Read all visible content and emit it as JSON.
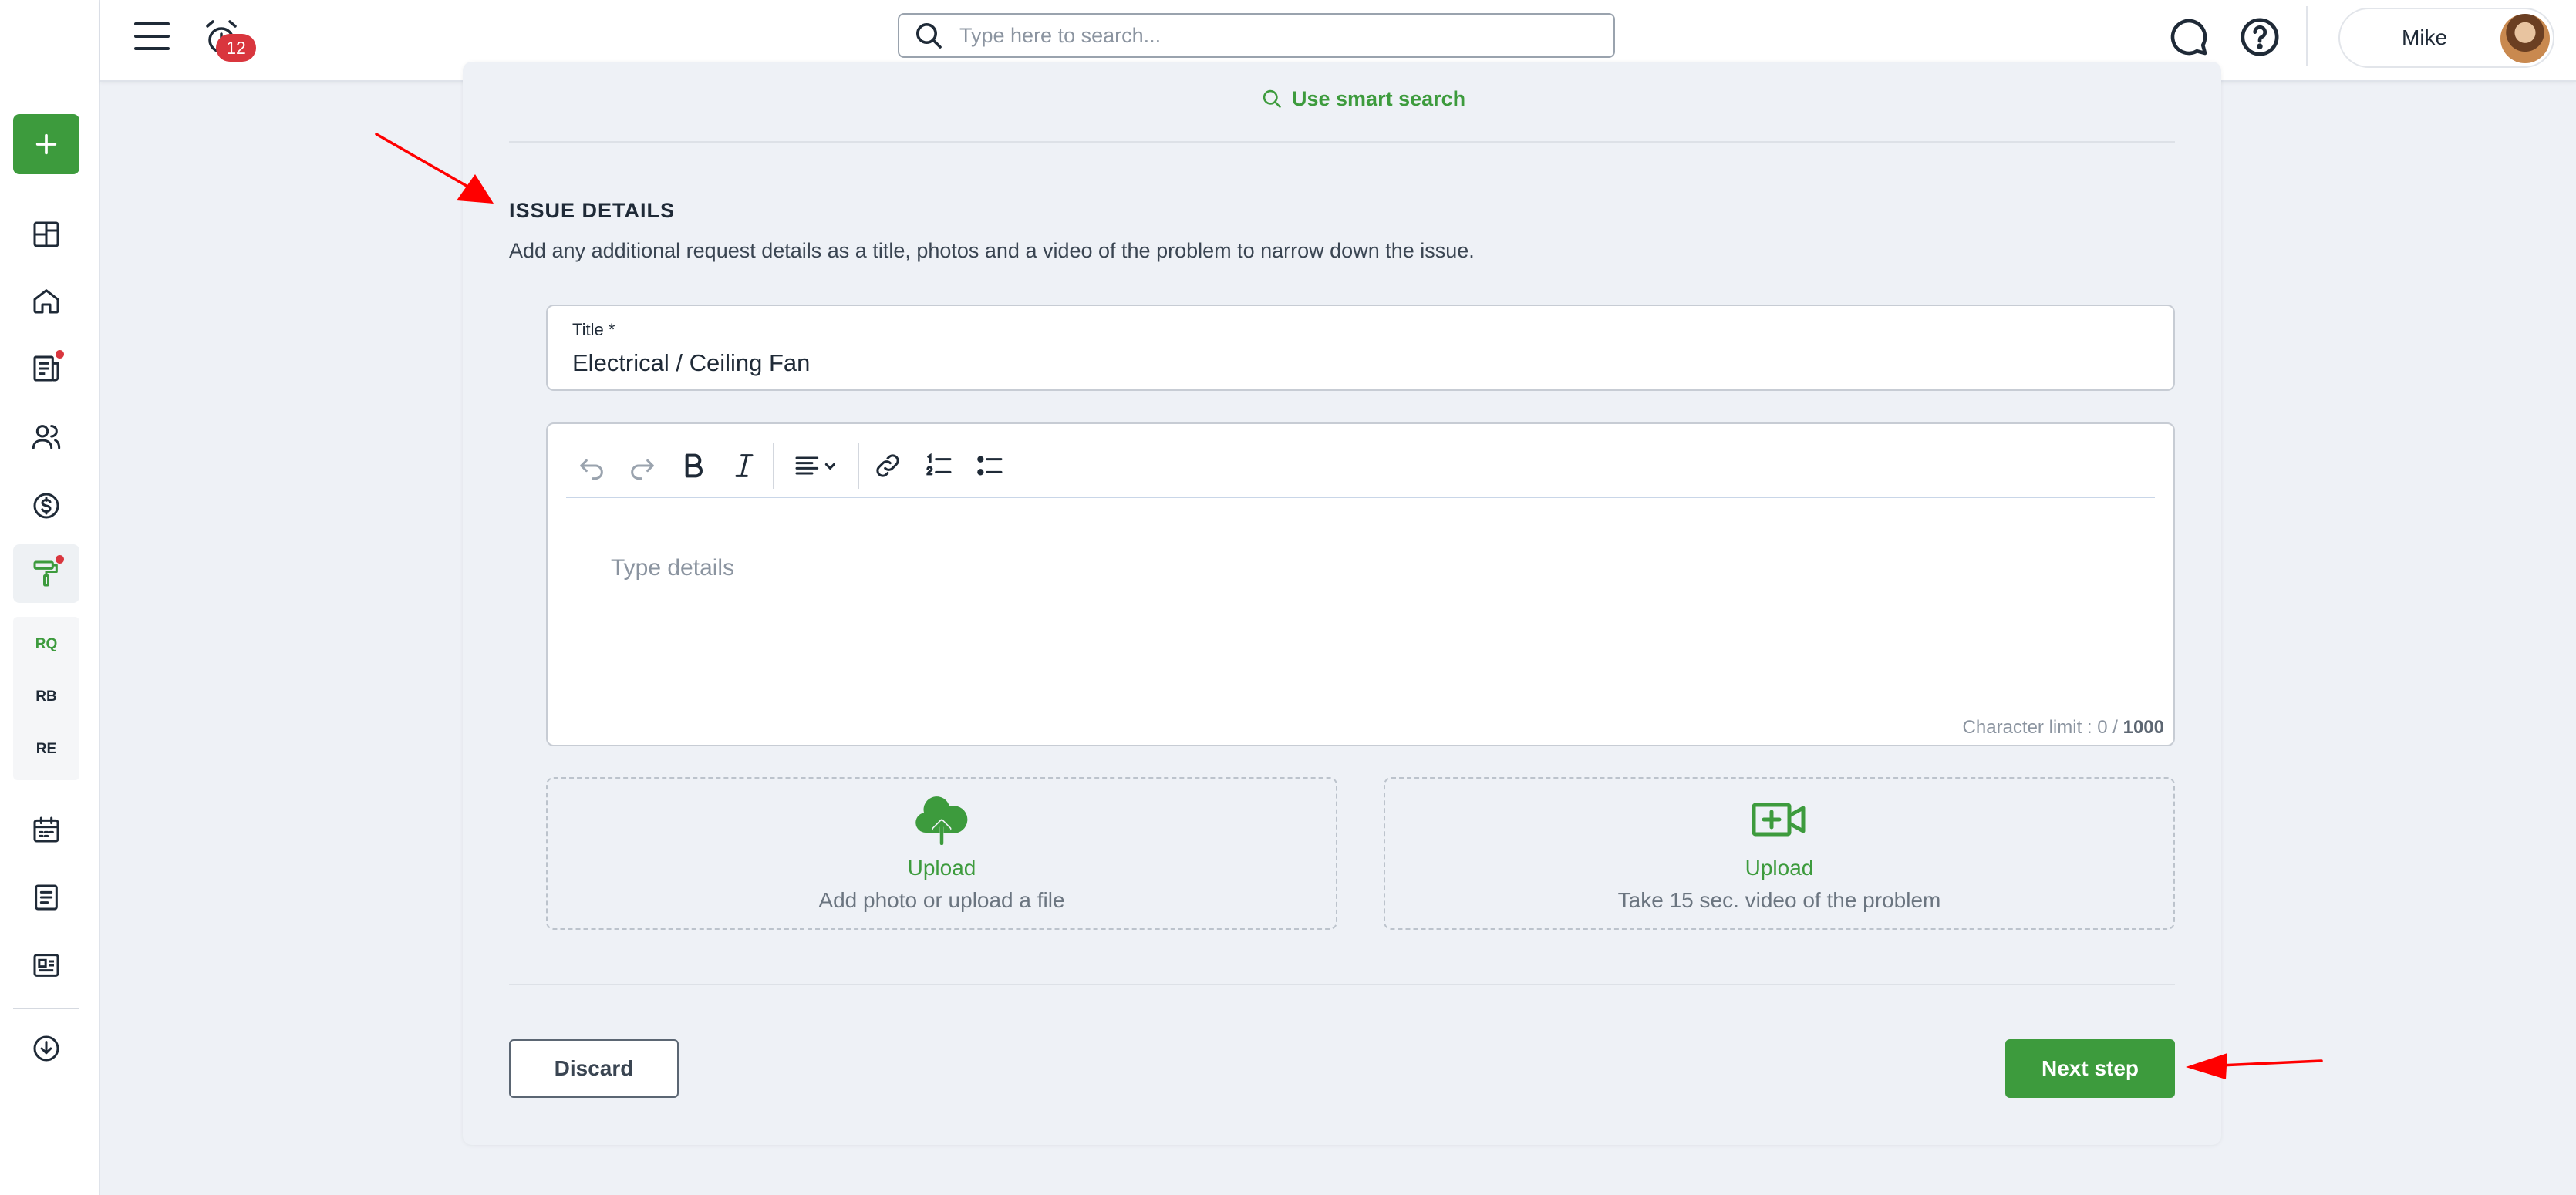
{
  "topbar": {
    "notification_count": "12",
    "search_placeholder": "Type here to search...",
    "user_name": "Mike"
  },
  "sidebar": {
    "items": [
      {
        "icon": "plus-icon"
      },
      {
        "icon": "dashboard-icon"
      },
      {
        "icon": "home-icon"
      },
      {
        "icon": "reports-icon",
        "dot": true
      },
      {
        "icon": "people-icon"
      },
      {
        "icon": "dollar-icon"
      },
      {
        "icon": "paint-roller-icon",
        "dot": true,
        "active": true
      },
      {
        "icon": "calendar-icon"
      },
      {
        "icon": "document-icon"
      },
      {
        "icon": "list-card-icon"
      },
      {
        "icon": "cloud-download-icon"
      }
    ],
    "sub_items": [
      "RQ",
      "RB",
      "RE"
    ]
  },
  "form": {
    "smart_search_label": "Use smart search",
    "section_title": "ISSUE DETAILS",
    "section_description": "Add any additional request details as a title, photos and a video of the problem to narrow down the issue.",
    "title_label": "Title *",
    "title_value": "Electrical / Ceiling Fan",
    "editor_placeholder": "Type details",
    "char_limit_prefix": "Character limit : 0 / ",
    "char_limit_max": "1000",
    "upload_photo_title": "Upload",
    "upload_photo_desc": "Add photo or upload a file",
    "upload_video_title": "Upload",
    "upload_video_desc": "Take 15 sec. video of the problem",
    "discard_label": "Discard",
    "next_label": "Next step"
  },
  "colors": {
    "accent": "#3d9b3d",
    "badge": "#d9363e",
    "annotation_arrow": "#ff0000"
  }
}
